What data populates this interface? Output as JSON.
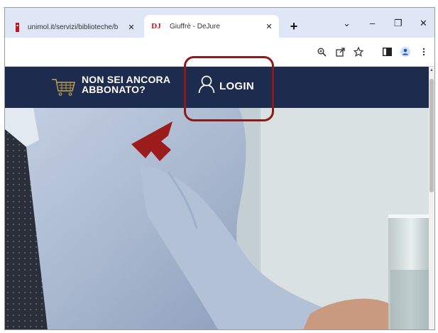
{
  "browser": {
    "tabs": [
      {
        "label": "unimol.it/servizi/biblioteche/b",
        "favicon": "red-flag-icon"
      },
      {
        "label": "Giuffrè - DeJure",
        "favicon_text": "DJ",
        "active": true
      }
    ],
    "new_tab_label": "+",
    "window_controls": {
      "menu": "⌄",
      "minimize": "–",
      "restore": "❐",
      "close": "✕"
    },
    "toolbar_icons": [
      "zoom-icon",
      "share-icon",
      "bookmark-star-icon",
      "sidebar-icon",
      "profile-icon",
      "more-menu-icon"
    ]
  },
  "site": {
    "not_subscribed_line1": "NON SEI ANCORA",
    "not_subscribed_line2": "ABBONATO?",
    "login_label": "LOGIN"
  },
  "colors": {
    "header_bg": "#1d2b4f",
    "annotation_red": "#8b1a1a",
    "tabstrip_bg": "#dfe7f7"
  }
}
